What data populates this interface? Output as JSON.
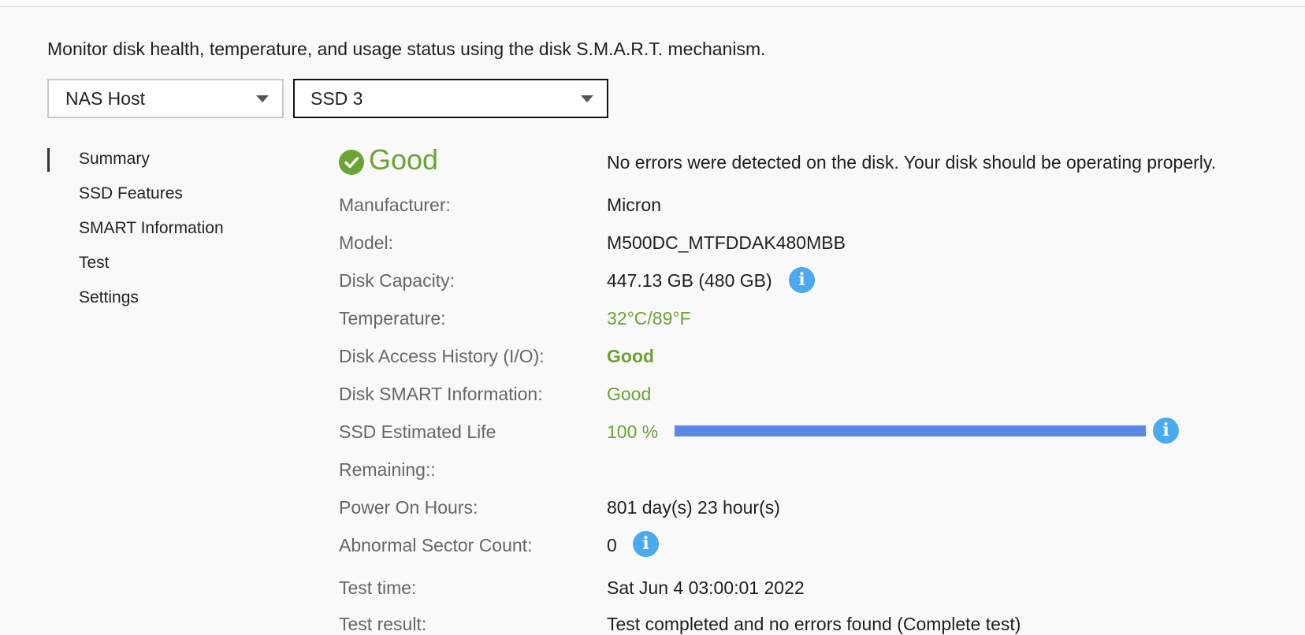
{
  "description": "Monitor disk health, temperature, and usage status using the disk S.M.A.R.T. mechanism.",
  "host_select": {
    "selected": "NAS Host"
  },
  "disk_select": {
    "selected": "SSD 3"
  },
  "nav": {
    "items": [
      {
        "label": "Summary",
        "active": true
      },
      {
        "label": "SSD Features"
      },
      {
        "label": "SMART Information"
      },
      {
        "label": "Test"
      },
      {
        "label": "Settings"
      }
    ]
  },
  "summary": {
    "status": "Good",
    "status_message": "No errors were detected on the disk. Your disk should be operating properly.",
    "status_color": "#6aa334",
    "fields": {
      "manufacturer": {
        "label": "Manufacturer:",
        "value": "Micron"
      },
      "model": {
        "label": "Model:",
        "value": "M500DC_MTFDDAK480MBB"
      },
      "capacity": {
        "label": "Disk Capacity:",
        "value": "447.13 GB (480 GB)"
      },
      "temperature": {
        "label": "Temperature:",
        "value": "32°C/89°F"
      },
      "access_history": {
        "label": "Disk Access History (I/O):",
        "value": "Good"
      },
      "smart_info": {
        "label": "Disk SMART Information:",
        "value": "Good"
      },
      "life_remaining": {
        "label_line1": "SSD Estimated Life",
        "label_line2": "Remaining::",
        "value": "100 %",
        "percent": 100
      },
      "power_on_hours": {
        "label": "Power On Hours:",
        "value": "801 day(s) 23 hour(s)"
      },
      "abnormal_sectors": {
        "label": "Abnormal Sector Count:",
        "value": "0"
      },
      "test_time": {
        "label": "Test time:",
        "value": "Sat Jun 4 03:00:01 2022"
      },
      "test_result": {
        "label": "Test result:",
        "value": "Test completed and no errors found (Complete test)"
      }
    },
    "bar_color": "#5b86e6",
    "info_color": "#4aa9ef"
  },
  "icons": {
    "status": "check-circle-icon",
    "info": "info-icon",
    "caret": "chevron-down-icon"
  }
}
